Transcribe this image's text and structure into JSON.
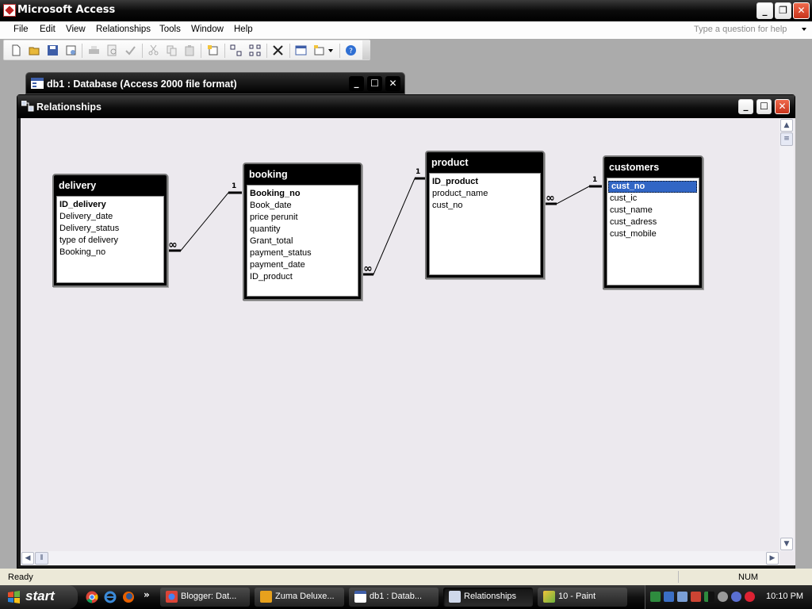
{
  "app": {
    "title": "Microsoft Access"
  },
  "menu": {
    "items": [
      "File",
      "Edit",
      "View",
      "Relationships",
      "Tools",
      "Window",
      "Help"
    ],
    "help_placeholder": "Type a question for help"
  },
  "toolbar": {
    "icons": [
      "new-icon",
      "open-icon",
      "save-icon",
      "properties-icon",
      "print-icon",
      "print-preview-icon",
      "spelling-icon",
      "cut-icon",
      "copy-icon",
      "paste-icon",
      "show-table-icon",
      "show-direct-icon",
      "show-all-icon",
      "delete-icon",
      "database-window-icon",
      "new-object-icon",
      "help-icon"
    ]
  },
  "db_window": {
    "title": "db1 : Database (Access 2000 file format)"
  },
  "relationships_window": {
    "title": "Relationships"
  },
  "tables": {
    "delivery": {
      "name": "delivery",
      "fields": [
        "ID_delivery",
        "Delivery_date",
        "Delivery_status",
        "type of delivery",
        "Booking_no"
      ]
    },
    "booking": {
      "name": "booking",
      "fields": [
        "Booking_no",
        "Book_date",
        "price perunit",
        "quantity",
        "Grant_total",
        "payment_status",
        "payment_date",
        "ID_product"
      ]
    },
    "product": {
      "name": "product",
      "fields": [
        "ID_product",
        "product_name",
        "cust_no"
      ]
    },
    "customers": {
      "name": "customers",
      "fields": [
        "cust_no",
        "cust_ic",
        "cust_name",
        "cust_adress",
        "cust_mobile"
      ]
    }
  },
  "relations": {
    "one_label": "1",
    "many_label": "∞"
  },
  "statusbar": {
    "status": "Ready",
    "num": "NUM"
  },
  "taskbar": {
    "start_label": "start",
    "overflow": "»",
    "tasks": [
      "Blogger: Dat...",
      "Zuma Deluxe...",
      "db1 : Datab...",
      "Relationships",
      "10 - Paint"
    ],
    "clock": "10:10 PM"
  },
  "colors": {
    "selection": "#3166c5",
    "canvas": "#ece9ee",
    "close_button": "#d4482a"
  }
}
